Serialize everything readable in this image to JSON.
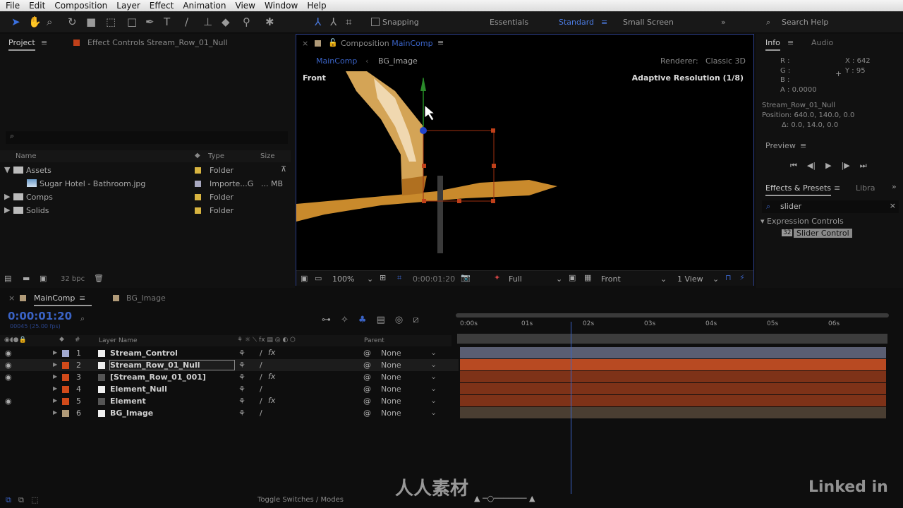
{
  "menu": [
    "File",
    "Edit",
    "Composition",
    "Layer",
    "Effect",
    "Animation",
    "View",
    "Window",
    "Help"
  ],
  "toolbar": {
    "snapping": "Snapping",
    "workspaces": [
      "Essentials",
      "Standard",
      "Small Screen"
    ],
    "active_workspace": "Standard",
    "search_help": "Search Help"
  },
  "project": {
    "tab": "Project",
    "effect_controls_tab": "Effect Controls Stream_Row_01_Null",
    "columns": {
      "name": "Name",
      "type": "Type",
      "size": "Size"
    },
    "items": [
      {
        "name": "Assets",
        "type": "Folder",
        "size": "",
        "expanded": true,
        "color": "#d8b440",
        "indent": 0
      },
      {
        "name": "Sugar Hotel - Bathroom.jpg",
        "type": "Importe...G",
        "size": "... MB",
        "color": "#a8a8c0",
        "indent": 1
      },
      {
        "name": "Comps",
        "type": "Folder",
        "size": "",
        "expanded": false,
        "color": "#d8b440",
        "indent": 0
      },
      {
        "name": "Solids",
        "type": "Folder",
        "size": "",
        "expanded": false,
        "color": "#d8b440",
        "indent": 0
      }
    ],
    "bpc": "32 bpc"
  },
  "composition": {
    "title_prefix": "Composition",
    "title_comp": "MainComp",
    "breadcrumbs": [
      "MainComp",
      "BG_Image"
    ],
    "renderer_label": "Renderer:",
    "renderer": "Classic 3D",
    "view_label": "Front",
    "adaptive": "Adaptive Resolution (1/8)",
    "footer": {
      "zoom": "100%",
      "timecode": "0:00:01:20",
      "resolution": "Full",
      "camera": "Front",
      "views": "1 View"
    }
  },
  "info": {
    "tab": "Info",
    "audio_tab": "Audio",
    "r": "R :",
    "g": "G :",
    "b": "B :",
    "a": "A : 0.0000",
    "x": "X : 642",
    "y": "Y : 95",
    "layer": "Stream_Row_01_Null",
    "position": "Position: 640.0, 140.0, 0.0",
    "delta": "Δ: 0.0, 14.0, 0.0"
  },
  "preview": {
    "title": "Preview"
  },
  "effects": {
    "tab": "Effects & Presets",
    "libraries_tab": "Libra",
    "search": "slider",
    "category": "Expression Controls",
    "item": "Slider Control"
  },
  "timeline": {
    "tabs": [
      "MainComp",
      "BG_Image"
    ],
    "timecode": "0:00:01:20",
    "frames": "00045 (25.00 fps)",
    "columns": {
      "layer_name": "Layer Name",
      "parent": "Parent",
      "num": "#"
    },
    "ruler": [
      "0:00s",
      "01s",
      "02s",
      "03s",
      "04s",
      "05s",
      "06s"
    ],
    "current_time_s": 1.8,
    "layers": [
      {
        "num": "1",
        "name": "Stream_Control",
        "label": "#a0a8d0",
        "visible": true,
        "fx": true,
        "parent": "None",
        "track": "#5a5e72"
      },
      {
        "num": "2",
        "name": "Stream_Row_01_Null",
        "label": "#d04a1a",
        "visible": true,
        "fx": false,
        "parent": "None",
        "track": "#b84a22",
        "selected": true
      },
      {
        "num": "3",
        "name": "[Stream_Row_01_001]",
        "label": "#d04a1a",
        "visible": true,
        "fx": true,
        "parent": "None",
        "track": "#7e3218"
      },
      {
        "num": "4",
        "name": "Element_Null",
        "label": "#d04a1a",
        "visible": false,
        "fx": false,
        "parent": "None",
        "track": "#7e3218"
      },
      {
        "num": "5",
        "name": "Element",
        "label": "#d04a1a",
        "visible": true,
        "fx": true,
        "parent": "None",
        "track": "#7e3218"
      },
      {
        "num": "6",
        "name": "BG_Image",
        "label": "#b09a78",
        "visible": false,
        "fx": false,
        "parent": "None",
        "track": "#4a3e32"
      }
    ],
    "toggle": "Toggle Switches / Modes"
  },
  "watermark": "人人素材",
  "brand": "Linked in"
}
